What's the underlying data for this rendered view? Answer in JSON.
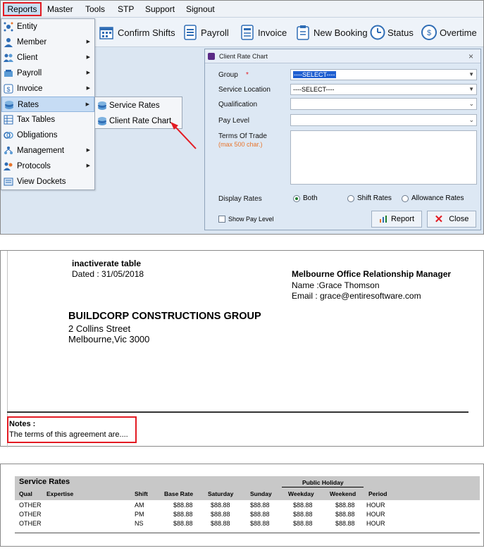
{
  "menubar": {
    "items": [
      "Reports",
      "Master",
      "Tools",
      "STP",
      "Support",
      "Signout"
    ]
  },
  "toolbar": {
    "confirm_shifts": "Confirm Shifts",
    "payroll": "Payroll",
    "invoice": "Invoice",
    "new_booking": "New Booking",
    "status": "Status",
    "overtime": "Overtime"
  },
  "dropdown": {
    "items": [
      {
        "label": "Entity",
        "icon": "entity-icon"
      },
      {
        "label": "Member",
        "icon": "member-icon"
      },
      {
        "label": "Client",
        "icon": "client-icon"
      },
      {
        "label": "Payroll",
        "icon": "payroll-icon"
      },
      {
        "label": "Invoice",
        "icon": "invoice-icon"
      },
      {
        "label": "Rates",
        "icon": "rates-icon"
      },
      {
        "label": "Tax Tables",
        "icon": "tax-tables-icon"
      },
      {
        "label": "Obligations",
        "icon": "obligations-icon"
      },
      {
        "label": "Management",
        "icon": "management-icon"
      },
      {
        "label": "Protocols",
        "icon": "protocols-icon"
      },
      {
        "label": "View Dockets",
        "icon": "view-dockets-icon"
      }
    ],
    "submenu": [
      "Service Rates",
      "Client Rate Chart"
    ]
  },
  "dialog": {
    "title": "Client Rate Chart",
    "close": "×",
    "group_label": "Group",
    "required_mark": "*",
    "group_value": "----SELECT----",
    "service_location_label": "Service Location",
    "service_location_value": "----SELECT----",
    "qualification_label": "Qualification",
    "qualification_value": "",
    "pay_level_label": "Pay Level",
    "pay_level_value": "",
    "terms_label": "Terms Of Trade",
    "terms_hint": "(max 500 char.)",
    "display_rates_label": "Display Rates",
    "radio_both": "Both",
    "radio_shift": "Shift Rates",
    "radio_allowance": "Allowance Rates",
    "show_pay_level": "Show Pay Level",
    "report_button": "Report",
    "close_button": "Close"
  },
  "report": {
    "heading": "inactiverate table",
    "dated": "Dated : 31/05/2018",
    "manager_title": "Melbourne Office Relationship Manager",
    "manager_name": "Name :Grace Thomson",
    "manager_email": "Email : grace@entiresoftware.com",
    "company": "BUILDCORP CONSTRUCTIONS GROUP",
    "address1": "2 Collins Street",
    "address2": "Melbourne,Vic 3000",
    "notes_label": "Notes :",
    "notes_text": "The terms of this agreement are...."
  },
  "rates_table": {
    "title": "Service Rates",
    "group_header": "Public Holiday",
    "columns": [
      "Qual",
      "Expertise",
      "Shift",
      "Base Rate",
      "Saturday",
      "Sunday",
      "Weekday",
      "Weekend",
      "Period"
    ],
    "rows": [
      [
        "OTHER",
        "",
        "AM",
        "$88.88",
        "$88.88",
        "$88.88",
        "$88.88",
        "$88.88",
        "HOUR"
      ],
      [
        "OTHER",
        "",
        "PM",
        "$88.88",
        "$88.88",
        "$88.88",
        "$88.88",
        "$88.88",
        "HOUR"
      ],
      [
        "OTHER",
        "",
        "NS",
        "$88.88",
        "$88.88",
        "$88.88",
        "$88.88",
        "$88.88",
        "HOUR"
      ]
    ]
  },
  "colors": {
    "highlight_red": "#e31b23",
    "hint_orange": "#e8742a",
    "selection_blue": "#1f5fd1"
  }
}
